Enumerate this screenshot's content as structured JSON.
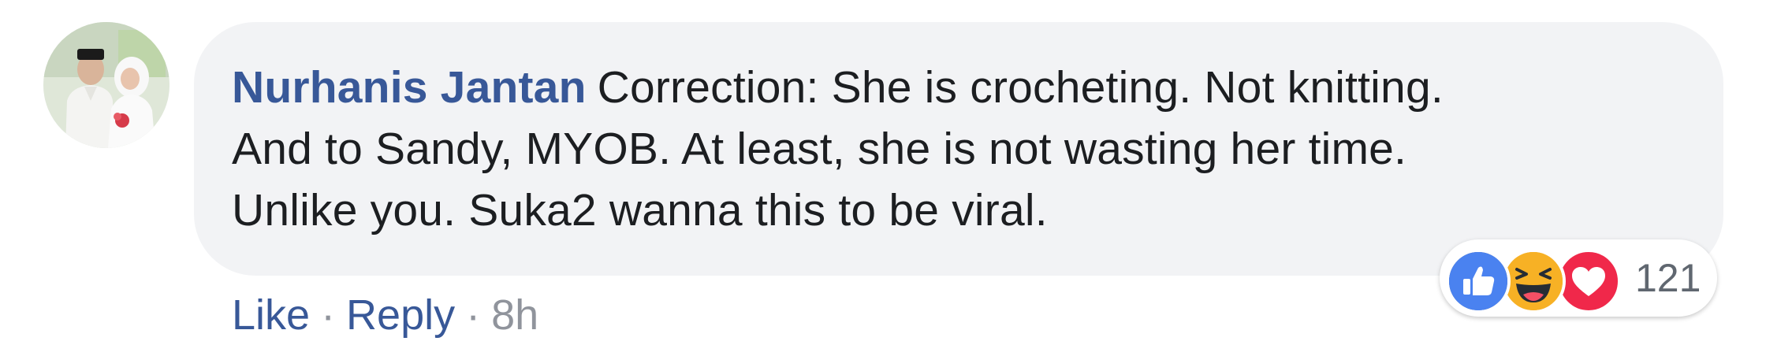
{
  "comment": {
    "author": "Nurhanis Jantan",
    "line1": "Correction: She is crocheting. Not knitting.",
    "line2": "And to Sandy, MYOB. At least, she is not wasting her time.",
    "line3": "Unlike you. Suka2 wanna this to be viral."
  },
  "actions": {
    "like_label": "Like",
    "reply_label": "Reply",
    "separator": "·",
    "timestamp": "8h"
  },
  "reactions": {
    "icons": [
      "like-icon",
      "haha-icon",
      "love-icon"
    ],
    "count": "121",
    "colors": {
      "like": "#4267b2",
      "haha": "#f7b125",
      "love": "#f0284a"
    }
  },
  "colors": {
    "link": "#385898",
    "bubble": "#f2f3f5",
    "text": "#1c1e21",
    "meta": "#90949c"
  }
}
